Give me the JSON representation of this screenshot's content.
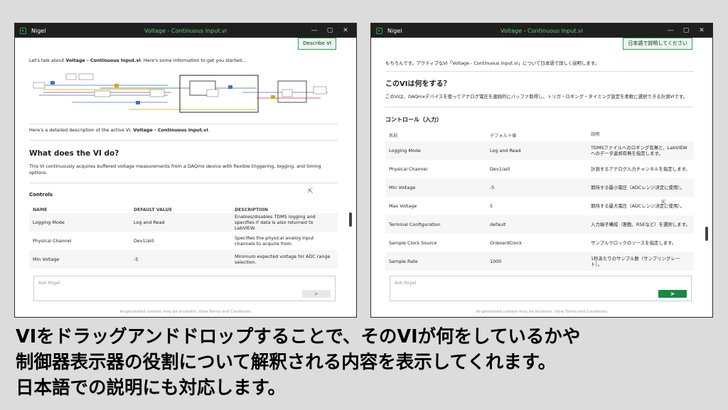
{
  "windows": [
    {
      "app_name": "Nigel",
      "title": "Voltage - Continuous Input.vi",
      "controls": [
        "—",
        "▢",
        "✕"
      ],
      "top_button": "Describe VI",
      "intro_pre": "Let's talk about ",
      "intro_bold": "Voltage - Continuous Input.vi",
      "intro_post": ". Here's some information to get you started...",
      "detail_pre": "Here's a detailed description of the active VI, ",
      "detail_bold": "Voltage - Continuous Input.vi",
      "detail_post": ".",
      "heading": "What does the VI do?",
      "paragraph": "This VI continuously acquires buffered voltage measurements from a DAQmx device with flexible triggering, logging, and timing options.",
      "controls_heading": "Controls",
      "columns": [
        "NAME",
        "DEFAULT VALUE",
        "DESCRIPTION"
      ],
      "rows": [
        {
          "name": "Logging Mode",
          "default": "Log and Read",
          "desc": "Enables/disables TDMS logging and specifies if data is also returned to LabVIEW."
        },
        {
          "name": "Physical Channel",
          "default": "Dev1/ai0",
          "desc": "Specifies the physical analog input channels to acquire from."
        },
        {
          "name": "Min Voltage",
          "default": "-5",
          "desc": "Minimum expected voltage for ADC range selection."
        }
      ],
      "ask_placeholder": "Ask Nigel",
      "send_icon": "➤",
      "footer": "AI-generated content may be incorrect.  View Terms and Conditions"
    },
    {
      "app_name": "Nigel",
      "title": "Voltage - Continuous Input.vi",
      "controls": [
        "—",
        "▢",
        "✕"
      ],
      "top_button": "日本語で説明してください",
      "intro": "もちろんです。アクティブなVI「Voltage - Continuous Input.vi」について日本語で詳しく説明します。",
      "heading": "このVIは何をする？",
      "paragraph": "このVIは、DAQmxデバイスを使ってアナログ電圧を連続的にバッファ取得し、トリガ・ロギング・タイミング設定を柔軟に選択できる計測VIです。",
      "controls_heading": "コントロール（入力）",
      "columns": [
        "名前",
        "デフォルト値",
        "説明"
      ],
      "rows": [
        {
          "name": "Logging Mode",
          "default": "Log and Read",
          "desc": "TDMSファイルへのロギング有無と、LabVIEWへのデータ返却有無を指定します。"
        },
        {
          "name": "Physical Channel",
          "default": "Dev1/ai0",
          "desc": "計測するアナログ入力チャンネルを指定します。"
        },
        {
          "name": "Min Voltage",
          "default": "-5",
          "desc": "期待する最小電圧（ADCレンジ決定に使用）。"
        },
        {
          "name": "Max Voltage",
          "default": "5",
          "desc": "期待する最大電圧（ADCレンジ決定に使用）。"
        },
        {
          "name": "Terminal Configuration",
          "default": "default",
          "desc": "入力端子構成（差動、RSEなど）を選択します。"
        },
        {
          "name": "Sample Clock Source",
          "default": "OnboardClock",
          "desc": "サンプルクロックのソースを指定します。"
        },
        {
          "name": "Sample Rate",
          "default": "1000",
          "desc": "1秒あたりのサンプル数（サンプリングレート）。"
        }
      ],
      "ask_placeholder": "Ask Nigel",
      "send_icon": "➤",
      "footer": "AI-generated content may be incorrect.  View Terms and Conditions"
    }
  ],
  "caption": {
    "line1": "VIをドラッグアンドドロップすることで、そのVIが何をしているかや",
    "line2": "制御器表示器の役割について解釈される内容を表示してくれます。",
    "line3": "日本語での説明にも対応します。"
  },
  "colors": {
    "accent": "#2ea44f",
    "send_active": "#168a43",
    "titlebar": "#1f1f1f"
  }
}
